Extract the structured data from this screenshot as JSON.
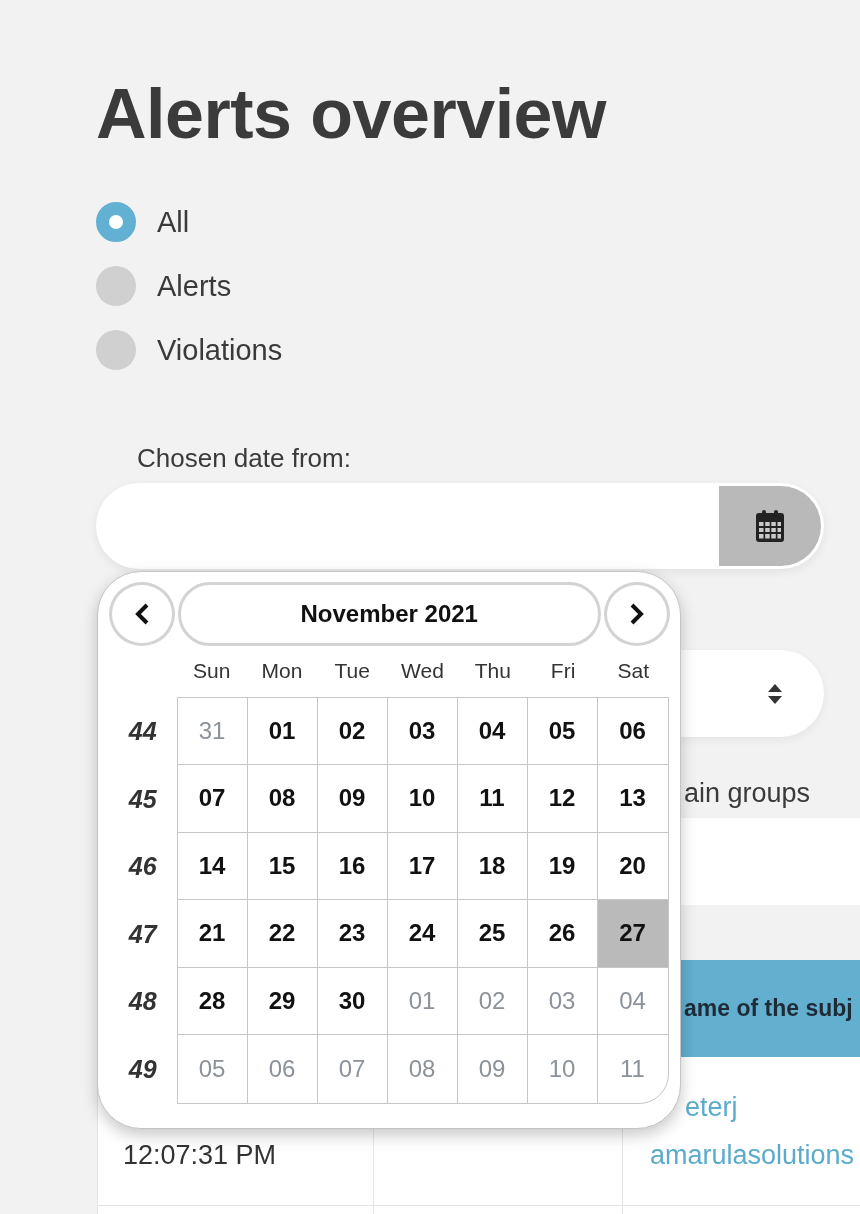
{
  "page": {
    "title": "Alerts overview"
  },
  "filter": [
    {
      "label": "All",
      "selected": true
    },
    {
      "label": "Alerts",
      "selected": false
    },
    {
      "label": "Violations",
      "selected": false
    }
  ],
  "date_from": {
    "label": "Chosen date from:"
  },
  "calendar": {
    "month": "November 2021",
    "weekdays": [
      "Sun",
      "Mon",
      "Tue",
      "Wed",
      "Thu",
      "Fri",
      "Sat"
    ],
    "weeks": [
      {
        "number": "44",
        "days": [
          {
            "day": "31",
            "other_month": true,
            "selected": false
          },
          {
            "day": "01",
            "other_month": false,
            "selected": false
          },
          {
            "day": "02",
            "other_month": false,
            "selected": false
          },
          {
            "day": "03",
            "other_month": false,
            "selected": false
          },
          {
            "day": "04",
            "other_month": false,
            "selected": false
          },
          {
            "day": "05",
            "other_month": false,
            "selected": false
          },
          {
            "day": "06",
            "other_month": false,
            "selected": false
          }
        ]
      },
      {
        "number": "45",
        "days": [
          {
            "day": "07",
            "other_month": false,
            "selected": false
          },
          {
            "day": "08",
            "other_month": false,
            "selected": false
          },
          {
            "day": "09",
            "other_month": false,
            "selected": false
          },
          {
            "day": "10",
            "other_month": false,
            "selected": false
          },
          {
            "day": "11",
            "other_month": false,
            "selected": false
          },
          {
            "day": "12",
            "other_month": false,
            "selected": false
          },
          {
            "day": "13",
            "other_month": false,
            "selected": false
          }
        ]
      },
      {
        "number": "46",
        "days": [
          {
            "day": "14",
            "other_month": false,
            "selected": false
          },
          {
            "day": "15",
            "other_month": false,
            "selected": false
          },
          {
            "day": "16",
            "other_month": false,
            "selected": false
          },
          {
            "day": "17",
            "other_month": false,
            "selected": false
          },
          {
            "day": "18",
            "other_month": false,
            "selected": false
          },
          {
            "day": "19",
            "other_month": false,
            "selected": false
          },
          {
            "day": "20",
            "other_month": false,
            "selected": false
          }
        ]
      },
      {
        "number": "47",
        "days": [
          {
            "day": "21",
            "other_month": false,
            "selected": false
          },
          {
            "day": "22",
            "other_month": false,
            "selected": false
          },
          {
            "day": "23",
            "other_month": false,
            "selected": false
          },
          {
            "day": "24",
            "other_month": false,
            "selected": false
          },
          {
            "day": "25",
            "other_month": false,
            "selected": false
          },
          {
            "day": "26",
            "other_month": false,
            "selected": false
          },
          {
            "day": "27",
            "other_month": false,
            "selected": true
          }
        ]
      },
      {
        "number": "48",
        "days": [
          {
            "day": "28",
            "other_month": false,
            "selected": false
          },
          {
            "day": "29",
            "other_month": false,
            "selected": false
          },
          {
            "day": "30",
            "other_month": false,
            "selected": false
          },
          {
            "day": "01",
            "other_month": true,
            "selected": false
          },
          {
            "day": "02",
            "other_month": true,
            "selected": false
          },
          {
            "day": "03",
            "other_month": true,
            "selected": false
          },
          {
            "day": "04",
            "other_month": true,
            "selected": false
          }
        ]
      },
      {
        "number": "49",
        "days": [
          {
            "day": "05",
            "other_month": true,
            "selected": false
          },
          {
            "day": "06",
            "other_month": true,
            "selected": false
          },
          {
            "day": "07",
            "other_month": true,
            "selected": false
          },
          {
            "day": "08",
            "other_month": true,
            "selected": false
          },
          {
            "day": "09",
            "other_month": true,
            "selected": false
          },
          {
            "day": "10",
            "other_month": true,
            "selected": false
          },
          {
            "day": "11",
            "other_month": true,
            "selected": false
          }
        ]
      }
    ]
  },
  "groups_field": {
    "label": "ain groups"
  },
  "table": {
    "column_3_header": "ame of the subj",
    "rows": [
      {
        "column_1": "12:07:31 PM",
        "column_3": [
          "eterj",
          "amarulasolutions"
        ]
      }
    ]
  }
}
